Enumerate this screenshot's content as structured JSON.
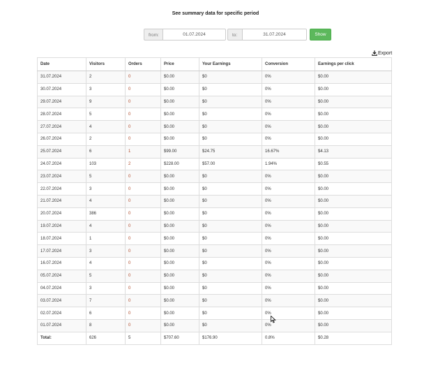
{
  "page": {
    "title": "See summary data for specific period"
  },
  "filter": {
    "from_label": "from:",
    "from_value": "01.07.2024",
    "to_label": "to:",
    "to_value": "31.07.2024",
    "show_label": "Show"
  },
  "export": {
    "label": "Export",
    "icon": "download-icon"
  },
  "table": {
    "headers": [
      "Date",
      "Visitors",
      "Orders",
      "Price",
      "Your Earnings",
      "Conversion",
      "Earnings per click"
    ],
    "rows": [
      [
        "31.07.2024",
        "2",
        "0",
        "$0.00",
        "$0",
        "0%",
        "$0.00"
      ],
      [
        "30.07.2024",
        "3",
        "0",
        "$0.00",
        "$0",
        "0%",
        "$0.00"
      ],
      [
        "29.07.2024",
        "9",
        "0",
        "$0.00",
        "$0",
        "0%",
        "$0.00"
      ],
      [
        "28.07.2024",
        "5",
        "0",
        "$0.00",
        "$0",
        "0%",
        "$0.00"
      ],
      [
        "27.07.2024",
        "4",
        "0",
        "$0.00",
        "$0",
        "0%",
        "$0.00"
      ],
      [
        "26.07.2024",
        "2",
        "0",
        "$0.00",
        "$0",
        "0%",
        "$0.00"
      ],
      [
        "25.07.2024",
        "6",
        "1",
        "$99.00",
        "$24.75",
        "16.67%",
        "$4.13"
      ],
      [
        "24.07.2024",
        "103",
        "2",
        "$228.00",
        "$57.00",
        "1.94%",
        "$0.55"
      ],
      [
        "23.07.2024",
        "5",
        "0",
        "$0.00",
        "$0",
        "0%",
        "$0.00"
      ],
      [
        "22.07.2024",
        "3",
        "0",
        "$0.00",
        "$0",
        "0%",
        "$0.00"
      ],
      [
        "21.07.2024",
        "4",
        "0",
        "$0.00",
        "$0",
        "0%",
        "$0.00"
      ],
      [
        "20.07.2024",
        "386",
        "0",
        "$0.00",
        "$0",
        "0%",
        "$0.00"
      ],
      [
        "19.07.2024",
        "4",
        "0",
        "$0.00",
        "$0",
        "0%",
        "$0.00"
      ],
      [
        "18.07.2024",
        "1",
        "0",
        "$0.00",
        "$0",
        "0%",
        "$0.00"
      ],
      [
        "17.07.2024",
        "3",
        "0",
        "$0.00",
        "$0",
        "0%",
        "$0.00"
      ],
      [
        "16.07.2024",
        "4",
        "0",
        "$0.00",
        "$0",
        "0%",
        "$0.00"
      ],
      [
        "05.07.2024",
        "5",
        "0",
        "$0.00",
        "$0",
        "0%",
        "$0.00"
      ],
      [
        "04.07.2024",
        "3",
        "0",
        "$0.00",
        "$0",
        "0%",
        "$0.00"
      ],
      [
        "03.07.2024",
        "7",
        "0",
        "$0.00",
        "$0",
        "0%",
        "$0.00"
      ],
      [
        "02.07.2024",
        "6",
        "0",
        "$0.00",
        "$0",
        "0%",
        "$0.00"
      ],
      [
        "01.07.2024",
        "8",
        "0",
        "$0.00",
        "$0",
        "0%",
        "$0.00"
      ]
    ],
    "totals": {
      "label": "Total:",
      "visitors": "626",
      "orders": "5",
      "price": "$707.60",
      "earnings": "$176.90",
      "conversion": "0.8%",
      "epc": "$0.28"
    }
  },
  "colors": {
    "accent_button": "#5cb85c",
    "orders_text": "#b04a2a"
  }
}
